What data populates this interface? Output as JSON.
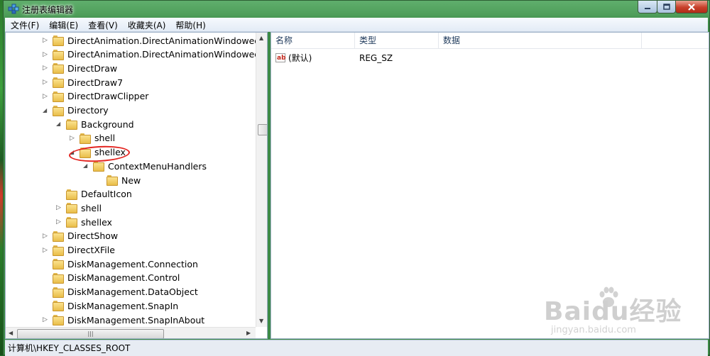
{
  "window": {
    "title": "注册表编辑器"
  },
  "menu": [
    "文件(F)",
    "编辑(E)",
    "查看(V)",
    "收藏夹(A)",
    "帮助(H)"
  ],
  "tree": [
    {
      "label": "DirectAnimation.DirectAnimationWindowedInte",
      "depth": 0,
      "expander": "collapsed"
    },
    {
      "label": "DirectAnimation.DirectAnimationWindowedInte",
      "depth": 0,
      "expander": "collapsed"
    },
    {
      "label": "DirectDraw",
      "depth": 0,
      "expander": "collapsed"
    },
    {
      "label": "DirectDraw7",
      "depth": 0,
      "expander": "collapsed"
    },
    {
      "label": "DirectDrawClipper",
      "depth": 0,
      "expander": "collapsed"
    },
    {
      "label": "Directory",
      "depth": 0,
      "expander": "expanded"
    },
    {
      "label": "Background",
      "depth": 1,
      "expander": "expanded"
    },
    {
      "label": "shell",
      "depth": 2,
      "expander": "collapsed"
    },
    {
      "label": "shellex",
      "depth": 2,
      "expander": "expanded"
    },
    {
      "label": "ContextMenuHandlers",
      "depth": 3,
      "expander": "expanded"
    },
    {
      "label": "New",
      "depth": 4,
      "expander": "none"
    },
    {
      "label": "DefaultIcon",
      "depth": 1,
      "expander": "none"
    },
    {
      "label": "shell",
      "depth": 1,
      "expander": "collapsed"
    },
    {
      "label": "shellex",
      "depth": 1,
      "expander": "collapsed"
    },
    {
      "label": "DirectShow",
      "depth": 0,
      "expander": "collapsed"
    },
    {
      "label": "DirectXFile",
      "depth": 0,
      "expander": "collapsed"
    },
    {
      "label": "DiskManagement.Connection",
      "depth": 0,
      "expander": "none"
    },
    {
      "label": "DiskManagement.Control",
      "depth": 0,
      "expander": "none"
    },
    {
      "label": "DiskManagement.DataObject",
      "depth": 0,
      "expander": "none"
    },
    {
      "label": "DiskManagement.SnapIn",
      "depth": 0,
      "expander": "none"
    },
    {
      "label": "DiskManagement.SnapInAbout",
      "depth": 0,
      "expander": "collapsed"
    }
  ],
  "list": {
    "headers": [
      "名称",
      "类型",
      "数据"
    ],
    "rows": [
      {
        "name": "(默认)",
        "type": "REG_SZ",
        "data": ""
      }
    ]
  },
  "status": "计算机\\HKEY_CLASSES_ROOT",
  "watermark": {
    "big": "Baidu经验",
    "small": "jingyan.baidu.com"
  },
  "colors": {
    "annotation": "#e3231f",
    "title_bar": "#4f9e5a"
  }
}
